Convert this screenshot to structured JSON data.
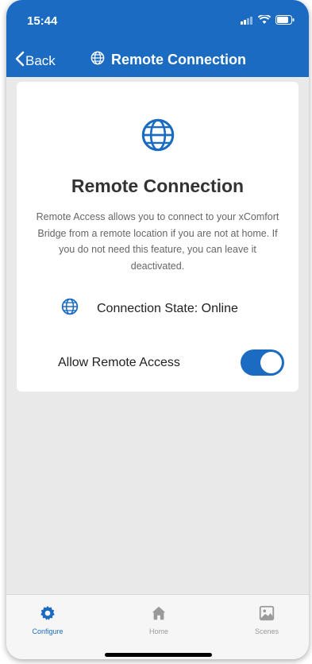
{
  "status_bar": {
    "time": "15:44"
  },
  "nav": {
    "back_label": "Back",
    "title": "Remote Connection"
  },
  "card": {
    "title": "Remote Connection",
    "description": "Remote Access allows you to connect to your xComfort Bridge from a remote location if you are not at home. If you do not need this feature, you can leave it deactivated.",
    "connection_state": "Connection State: Online",
    "allow_label": "Allow Remote Access",
    "allow_enabled": true
  },
  "tabbar": {
    "items": [
      {
        "label": "Configure",
        "icon": "gear-icon",
        "active": true
      },
      {
        "label": "Home",
        "icon": "home-icon",
        "active": false
      },
      {
        "label": "Scenes",
        "icon": "scenes-icon",
        "active": false
      }
    ]
  },
  "colors": {
    "accent": "#1a6bc1",
    "background": "#e9e9e9"
  }
}
